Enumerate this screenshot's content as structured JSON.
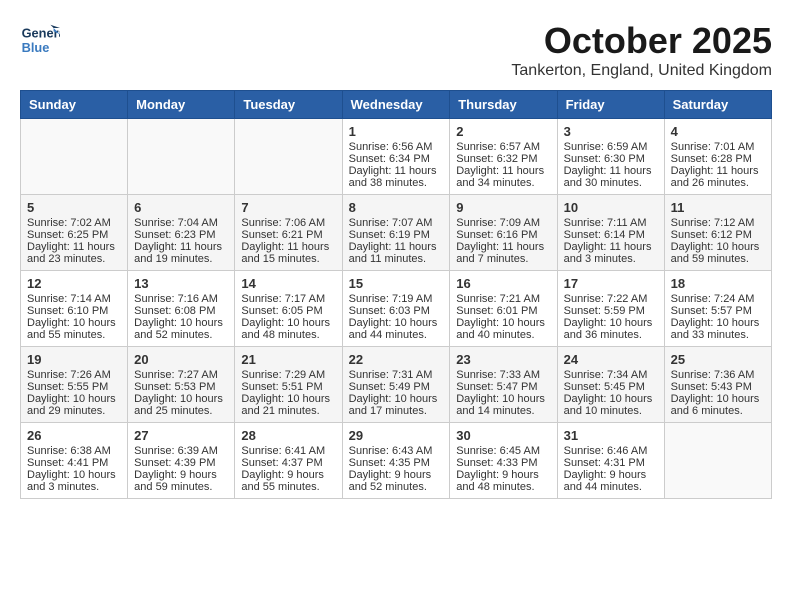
{
  "header": {
    "logo_general": "General",
    "logo_blue": "Blue",
    "month": "October 2025",
    "location": "Tankerton, England, United Kingdom"
  },
  "weekdays": [
    "Sunday",
    "Monday",
    "Tuesday",
    "Wednesday",
    "Thursday",
    "Friday",
    "Saturday"
  ],
  "weeks": [
    [
      {
        "day": "",
        "sunrise": "",
        "sunset": "",
        "daylight": ""
      },
      {
        "day": "",
        "sunrise": "",
        "sunset": "",
        "daylight": ""
      },
      {
        "day": "",
        "sunrise": "",
        "sunset": "",
        "daylight": ""
      },
      {
        "day": "1",
        "sunrise": "Sunrise: 6:56 AM",
        "sunset": "Sunset: 6:34 PM",
        "daylight": "Daylight: 11 hours and 38 minutes."
      },
      {
        "day": "2",
        "sunrise": "Sunrise: 6:57 AM",
        "sunset": "Sunset: 6:32 PM",
        "daylight": "Daylight: 11 hours and 34 minutes."
      },
      {
        "day": "3",
        "sunrise": "Sunrise: 6:59 AM",
        "sunset": "Sunset: 6:30 PM",
        "daylight": "Daylight: 11 hours and 30 minutes."
      },
      {
        "day": "4",
        "sunrise": "Sunrise: 7:01 AM",
        "sunset": "Sunset: 6:28 PM",
        "daylight": "Daylight: 11 hours and 26 minutes."
      }
    ],
    [
      {
        "day": "5",
        "sunrise": "Sunrise: 7:02 AM",
        "sunset": "Sunset: 6:25 PM",
        "daylight": "Daylight: 11 hours and 23 minutes."
      },
      {
        "day": "6",
        "sunrise": "Sunrise: 7:04 AM",
        "sunset": "Sunset: 6:23 PM",
        "daylight": "Daylight: 11 hours and 19 minutes."
      },
      {
        "day": "7",
        "sunrise": "Sunrise: 7:06 AM",
        "sunset": "Sunset: 6:21 PM",
        "daylight": "Daylight: 11 hours and 15 minutes."
      },
      {
        "day": "8",
        "sunrise": "Sunrise: 7:07 AM",
        "sunset": "Sunset: 6:19 PM",
        "daylight": "Daylight: 11 hours and 11 minutes."
      },
      {
        "day": "9",
        "sunrise": "Sunrise: 7:09 AM",
        "sunset": "Sunset: 6:16 PM",
        "daylight": "Daylight: 11 hours and 7 minutes."
      },
      {
        "day": "10",
        "sunrise": "Sunrise: 7:11 AM",
        "sunset": "Sunset: 6:14 PM",
        "daylight": "Daylight: 11 hours and 3 minutes."
      },
      {
        "day": "11",
        "sunrise": "Sunrise: 7:12 AM",
        "sunset": "Sunset: 6:12 PM",
        "daylight": "Daylight: 10 hours and 59 minutes."
      }
    ],
    [
      {
        "day": "12",
        "sunrise": "Sunrise: 7:14 AM",
        "sunset": "Sunset: 6:10 PM",
        "daylight": "Daylight: 10 hours and 55 minutes."
      },
      {
        "day": "13",
        "sunrise": "Sunrise: 7:16 AM",
        "sunset": "Sunset: 6:08 PM",
        "daylight": "Daylight: 10 hours and 52 minutes."
      },
      {
        "day": "14",
        "sunrise": "Sunrise: 7:17 AM",
        "sunset": "Sunset: 6:05 PM",
        "daylight": "Daylight: 10 hours and 48 minutes."
      },
      {
        "day": "15",
        "sunrise": "Sunrise: 7:19 AM",
        "sunset": "Sunset: 6:03 PM",
        "daylight": "Daylight: 10 hours and 44 minutes."
      },
      {
        "day": "16",
        "sunrise": "Sunrise: 7:21 AM",
        "sunset": "Sunset: 6:01 PM",
        "daylight": "Daylight: 10 hours and 40 minutes."
      },
      {
        "day": "17",
        "sunrise": "Sunrise: 7:22 AM",
        "sunset": "Sunset: 5:59 PM",
        "daylight": "Daylight: 10 hours and 36 minutes."
      },
      {
        "day": "18",
        "sunrise": "Sunrise: 7:24 AM",
        "sunset": "Sunset: 5:57 PM",
        "daylight": "Daylight: 10 hours and 33 minutes."
      }
    ],
    [
      {
        "day": "19",
        "sunrise": "Sunrise: 7:26 AM",
        "sunset": "Sunset: 5:55 PM",
        "daylight": "Daylight: 10 hours and 29 minutes."
      },
      {
        "day": "20",
        "sunrise": "Sunrise: 7:27 AM",
        "sunset": "Sunset: 5:53 PM",
        "daylight": "Daylight: 10 hours and 25 minutes."
      },
      {
        "day": "21",
        "sunrise": "Sunrise: 7:29 AM",
        "sunset": "Sunset: 5:51 PM",
        "daylight": "Daylight: 10 hours and 21 minutes."
      },
      {
        "day": "22",
        "sunrise": "Sunrise: 7:31 AM",
        "sunset": "Sunset: 5:49 PM",
        "daylight": "Daylight: 10 hours and 17 minutes."
      },
      {
        "day": "23",
        "sunrise": "Sunrise: 7:33 AM",
        "sunset": "Sunset: 5:47 PM",
        "daylight": "Daylight: 10 hours and 14 minutes."
      },
      {
        "day": "24",
        "sunrise": "Sunrise: 7:34 AM",
        "sunset": "Sunset: 5:45 PM",
        "daylight": "Daylight: 10 hours and 10 minutes."
      },
      {
        "day": "25",
        "sunrise": "Sunrise: 7:36 AM",
        "sunset": "Sunset: 5:43 PM",
        "daylight": "Daylight: 10 hours and 6 minutes."
      }
    ],
    [
      {
        "day": "26",
        "sunrise": "Sunrise: 6:38 AM",
        "sunset": "Sunset: 4:41 PM",
        "daylight": "Daylight: 10 hours and 3 minutes."
      },
      {
        "day": "27",
        "sunrise": "Sunrise: 6:39 AM",
        "sunset": "Sunset: 4:39 PM",
        "daylight": "Daylight: 9 hours and 59 minutes."
      },
      {
        "day": "28",
        "sunrise": "Sunrise: 6:41 AM",
        "sunset": "Sunset: 4:37 PM",
        "daylight": "Daylight: 9 hours and 55 minutes."
      },
      {
        "day": "29",
        "sunrise": "Sunrise: 6:43 AM",
        "sunset": "Sunset: 4:35 PM",
        "daylight": "Daylight: 9 hours and 52 minutes."
      },
      {
        "day": "30",
        "sunrise": "Sunrise: 6:45 AM",
        "sunset": "Sunset: 4:33 PM",
        "daylight": "Daylight: 9 hours and 48 minutes."
      },
      {
        "day": "31",
        "sunrise": "Sunrise: 6:46 AM",
        "sunset": "Sunset: 4:31 PM",
        "daylight": "Daylight: 9 hours and 44 minutes."
      },
      {
        "day": "",
        "sunrise": "",
        "sunset": "",
        "daylight": ""
      }
    ]
  ]
}
